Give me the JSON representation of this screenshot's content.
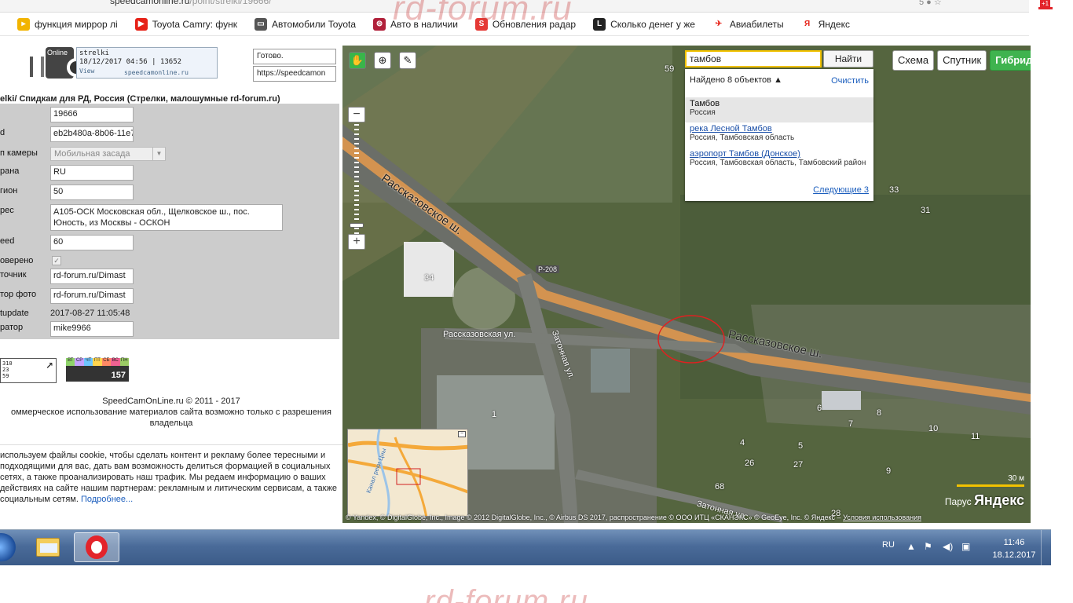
{
  "browser": {
    "url_host": "speedcamonline.ru",
    "url_path": "/point/strelki/19666/",
    "bookmarks": [
      {
        "label": "функция миррор лі",
        "icon": "arrow-play-icon",
        "color": "#f2b400",
        "glyph": "▸"
      },
      {
        "label": "Toyota Camry: функ",
        "icon": "youtube-icon",
        "color": "#e62117",
        "glyph": "▶"
      },
      {
        "label": "Автомобили Toyota",
        "icon": "car-icon",
        "color": "#555555",
        "glyph": "▭"
      },
      {
        "label": "Авто в наличии",
        "icon": "car-brand-icon",
        "color": "#b0203a",
        "glyph": "⊜"
      },
      {
        "label": "Обновления радар",
        "icon": "s-logo-icon",
        "color": "#e53935",
        "glyph": "S"
      },
      {
        "label": "Сколько денег у же",
        "icon": "l-logo-icon",
        "color": "#222222",
        "glyph": "L"
      },
      {
        "label": "Авиабилеты",
        "icon": "airplane-icon",
        "color": "#ffffff",
        "glyph": "✈"
      },
      {
        "label": "Яндекс",
        "icon": "yandex-icon",
        "color": "#ffffff",
        "glyph": "Я"
      }
    ],
    "ext_badge": "+1"
  },
  "watermark": "rd-forum.ru",
  "logo_label": "Online",
  "infobox": {
    "name": "strelki",
    "meta": "18/12/2017 04:56 | 13652",
    "view": "View",
    "site": "speedcamonline.ru"
  },
  "status_box": "Готово.",
  "url_box": "https://speedcamon",
  "page_title": "elki/ Спидкам для РД, Россия (Стрелки, малошумные rd-forum.ru)",
  "form": {
    "id_value": "19666",
    "uid_label": "d",
    "uid_value": "eb2b480a-8b06-11e7",
    "type_label": "п камеры",
    "type_value": "Мобильная засада",
    "country_label": "рана",
    "country_value": "RU",
    "region_label": "гион",
    "region_value": "50",
    "address_label": "рес",
    "address_value": "A105-ОСК Московская обл., Щелковское ш., пос. Юность, из Москвы - ОСКОН",
    "speed_label": "eed",
    "speed_value": "60",
    "verified_label": "оверено",
    "source_label": "точник",
    "source_value": "rd-forum.ru/Dimast",
    "photo_label": "тор фото",
    "photo_value": "rd-forum.ru/Dimast",
    "lastupdate_label": "tupdate",
    "lastupdate_value": "2017-08-27 11:05:48",
    "moderator_label": "ратор",
    "moderator_value": "mike9966"
  },
  "counter1_text": "310\n23\n59",
  "counter2": {
    "days": [
      "ВТ",
      "СР",
      "ЧТ",
      "ПТ",
      "СБ",
      "ВС",
      "ПН"
    ],
    "value": "157"
  },
  "copyright_line1": "SpeedCamOnLine.ru © 2011 - 2017",
  "copyright_line2": "оммерческое использование материалов сайта возможно только с разрешения",
  "copyright_line3": "владельца",
  "cookie_text": " используем файлы cookie, чтобы сделать контент и рекламу более тересными и подходящими для вас, дать вам возможность делиться формацией в социальных сетях, а также проанализировать наш трафик. Мы редаем информацию о ваших действиях на сайте нашим партнерам: рекламным и литическим сервисам, а также социальным сетям. ",
  "cookie_link": "Подробнее...",
  "map": {
    "search_value": "тамбов",
    "search_button": "Найти",
    "layers": [
      "Схема",
      "Спутник",
      "Гибрид"
    ],
    "active_layer": "Гибрид",
    "found_text": "Найдено 8 объектов",
    "clear_text": "Очистить",
    "results": [
      {
        "title": "Тамбов",
        "sub": "Россия"
      },
      {
        "title": "река Лесной Тамбов",
        "sub": "Россия, Тамбовская область"
      },
      {
        "title": "аэропорт Тамбов (Донское)",
        "sub": "Россия, Тамбовская область, Тамбовский район"
      }
    ],
    "next_text": "Следующие 3",
    "labels": {
      "road1": "Рассказовское ш.",
      "road2": "Рассказовское ш.",
      "street1": "Рассказовская ул.",
      "street2": "Затонная ул.",
      "street3": "Затонная ул.",
      "route": "Р-208",
      "mini_river": "Канал реки Цны"
    },
    "house_numbers": [
      "59",
      "33",
      "31",
      "34",
      "1",
      "6",
      "7",
      "8",
      "10",
      "11",
      "4",
      "5",
      "26",
      "27",
      "9",
      "68",
      "28"
    ],
    "scale_text": "30 м",
    "brand_small": "Парус",
    "brand": "Яндекс",
    "copyright": "© Yandex, © DigitalGlobe, Inc., Image © 2012 DigitalGlobe, Inc., © Airbus DS 2017, распространение © ООО ИТЦ «СКАНЭКС» © GeoEye, Inc. © Яндекс –",
    "terms_link": "Условия использования"
  },
  "taskbar": {
    "lang": "RU",
    "time": "11:46",
    "date": "18.12.2017"
  }
}
